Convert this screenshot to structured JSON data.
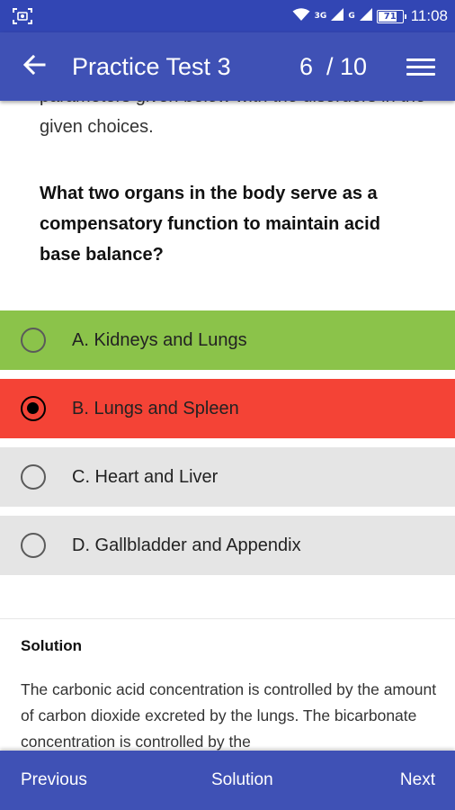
{
  "status_bar": {
    "network_left": "3G",
    "network_right": "G",
    "battery": "71",
    "battery_level": 0.71,
    "time": "11:08",
    "icons": [
      "screenshot-icon",
      "wifi-icon",
      "signal-icon",
      "signal-icon",
      "battery-icon"
    ]
  },
  "app_bar": {
    "title": "Practice Test 3",
    "counter": "6  / 10",
    "back_icon": "arrow-left-icon",
    "menu_icon": "hamburger-menu-icon"
  },
  "question": {
    "intro": "parameters given below with the disorders in the given choices.",
    "text": "What two organs in the body serve as a compensatory function to maintain acid base balance?"
  },
  "options": [
    {
      "label": "A. Kidneys and Lungs",
      "state": "correct",
      "selected": false,
      "color": "#8bc34a"
    },
    {
      "label": "B. Lungs and Spleen",
      "state": "wrong",
      "selected": true,
      "color": "#f44336"
    },
    {
      "label": "C. Heart and Liver",
      "state": "neutral",
      "selected": false,
      "color": "#e5e5e5"
    },
    {
      "label": "D. Gallbladder and Appendix",
      "state": "neutral",
      "selected": false,
      "color": "#e5e5e5"
    }
  ],
  "solution": {
    "title": "Solution",
    "text": "The carbonic acid concentration is controlled by the amount of carbon dioxide excreted by the lungs. The bicarbonate concentration is controlled by the"
  },
  "bottom_nav": {
    "previous": "Previous",
    "solution": "Solution",
    "next": "Next"
  },
  "colors": {
    "status_bar": "#3246b4",
    "primary": "#3f51b5",
    "correct": "#8bc34a",
    "wrong": "#f44336",
    "neutral": "#e5e5e5"
  }
}
